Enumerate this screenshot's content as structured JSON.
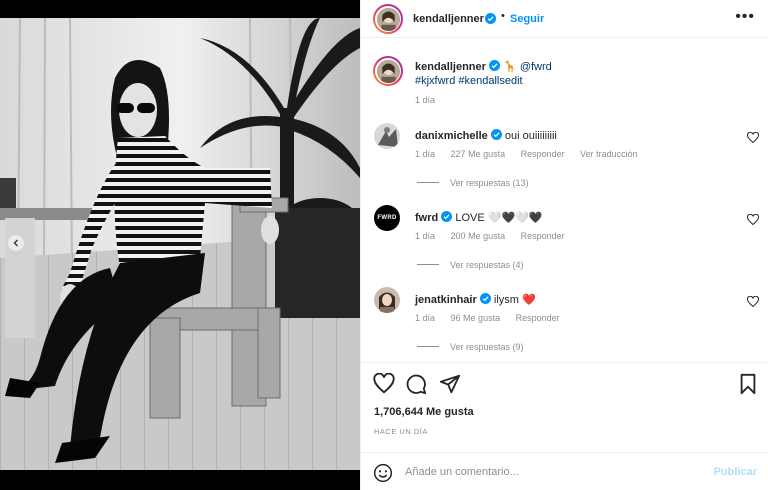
{
  "post": {
    "author": "kendalljenner",
    "follow_label": "Seguir",
    "separator": "•",
    "more_label": "•••"
  },
  "caption": {
    "username": "kendalljenner",
    "mention": "@fwrd",
    "emoji": "🦒",
    "hashtags": "#kjxfwrd #kendallsedit",
    "time": "1 día"
  },
  "comments": [
    {
      "username": "danixmichelle",
      "text": "oui ouiiiiiiiii",
      "time": "1 día",
      "likes": "227 Me gusta",
      "reply": "Responder",
      "translate": "Ver traducción",
      "view_replies": "Ver respuestas (13)"
    },
    {
      "username": "fwrd",
      "text": "LOVE 🤍🖤🤍🖤",
      "time": "1 día",
      "likes": "200 Me gusta",
      "reply": "Responder",
      "avatar_text": "FWRD",
      "view_replies": "Ver respuestas (4)"
    },
    {
      "username": "jenatkinhair",
      "text": "ilysm ❤️",
      "time": "1 día",
      "likes": "96 Me gusta",
      "reply": "Responder",
      "view_replies": "Ver respuestas (9)"
    }
  ],
  "stats": {
    "likes": "1,706,644 Me gusta",
    "date": "HACE UN DÍA"
  },
  "composer": {
    "placeholder": "Añade un comentario...",
    "publish_label": "Publicar"
  },
  "colors": {
    "accent": "#0095f6",
    "publish_disabled": "#b2dffc",
    "muted": "#8e8e8e",
    "text": "#262626",
    "heart_red": "#ed4956"
  },
  "icons": [
    "chevron-left-icon",
    "verified-badge-icon",
    "more-icon",
    "heart-icon",
    "comment-icon",
    "share-icon",
    "bookmark-icon",
    "emoji-icon"
  ]
}
